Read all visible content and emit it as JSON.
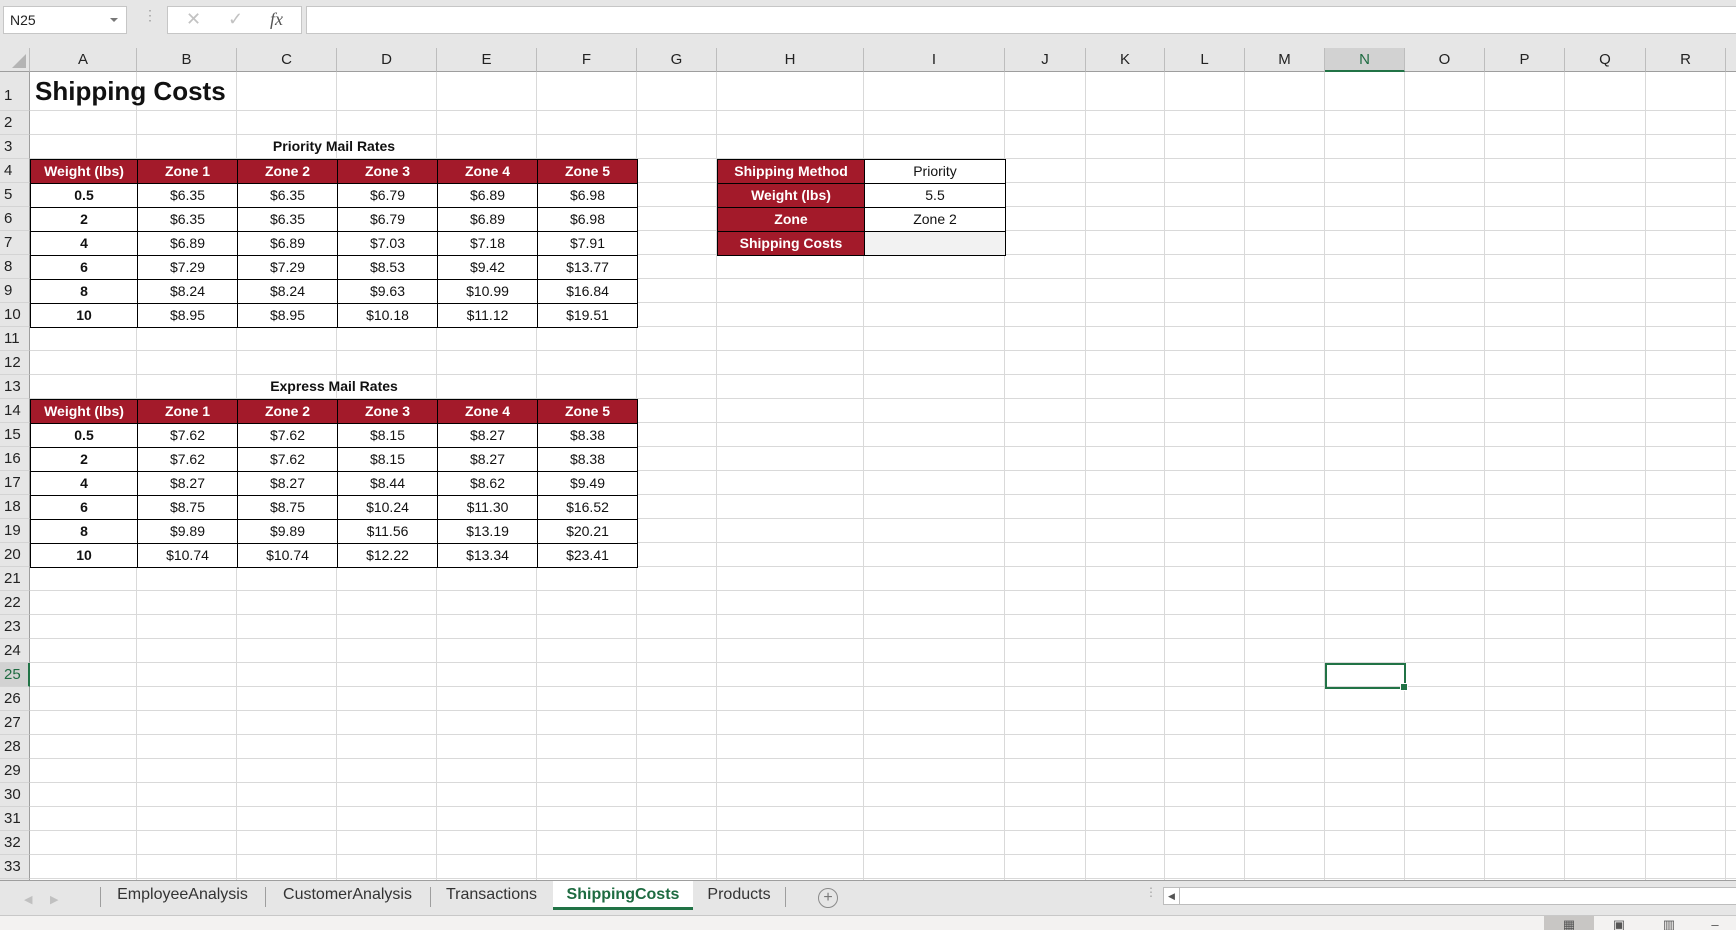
{
  "formula_bar": {
    "name_box": "N25",
    "cancel_icon": "✕",
    "enter_icon": "✓",
    "fx_label": "fx",
    "formula_value": ""
  },
  "columns": [
    "A",
    "B",
    "C",
    "D",
    "E",
    "F",
    "G",
    "H",
    "I",
    "J",
    "K",
    "L",
    "M",
    "N",
    "O",
    "P",
    "Q",
    "R"
  ],
  "selected_column": "N",
  "selected_row": 25,
  "rows": [
    1,
    2,
    3,
    4,
    5,
    6,
    7,
    8,
    9,
    10,
    11,
    12,
    13,
    14,
    15,
    16,
    17,
    18,
    19,
    20,
    21,
    22,
    23,
    24,
    25,
    26,
    27,
    28,
    29,
    30,
    31,
    32,
    33
  ],
  "sheet": {
    "title": "Shipping Costs",
    "priority": {
      "caption": "Priority Mail Rates",
      "headers": [
        "Weight (lbs)",
        "Zone 1",
        "Zone 2",
        "Zone 3",
        "Zone 4",
        "Zone 5"
      ],
      "rows": [
        [
          "0.5",
          "$6.35",
          "$6.35",
          "$6.79",
          "$6.89",
          "$6.98"
        ],
        [
          "2",
          "$6.35",
          "$6.35",
          "$6.79",
          "$6.89",
          "$6.98"
        ],
        [
          "4",
          "$6.89",
          "$6.89",
          "$7.03",
          "$7.18",
          "$7.91"
        ],
        [
          "6",
          "$7.29",
          "$7.29",
          "$8.53",
          "$9.42",
          "$13.77"
        ],
        [
          "8",
          "$8.24",
          "$8.24",
          "$9.63",
          "$10.99",
          "$16.84"
        ],
        [
          "10",
          "$8.95",
          "$8.95",
          "$10.18",
          "$11.12",
          "$19.51"
        ]
      ]
    },
    "express": {
      "caption": "Express Mail Rates",
      "headers": [
        "Weight (lbs)",
        "Zone 1",
        "Zone 2",
        "Zone 3",
        "Zone 4",
        "Zone 5"
      ],
      "rows": [
        [
          "0.5",
          "$7.62",
          "$7.62",
          "$8.15",
          "$8.27",
          "$8.38"
        ],
        [
          "2",
          "$7.62",
          "$7.62",
          "$8.15",
          "$8.27",
          "$8.38"
        ],
        [
          "4",
          "$8.27",
          "$8.27",
          "$8.44",
          "$8.62",
          "$9.49"
        ],
        [
          "6",
          "$8.75",
          "$8.75",
          "$10.24",
          "$11.30",
          "$16.52"
        ],
        [
          "8",
          "$9.89",
          "$9.89",
          "$11.56",
          "$13.19",
          "$20.21"
        ],
        [
          "10",
          "$10.74",
          "$10.74",
          "$12.22",
          "$13.34",
          "$23.41"
        ]
      ]
    },
    "calculator": [
      {
        "label": "Shipping Method",
        "value": "Priority"
      },
      {
        "label": "Weight (lbs)",
        "value": "5.5"
      },
      {
        "label": "Zone",
        "value": "Zone 2"
      },
      {
        "label": "Shipping Costs",
        "value": ""
      }
    ]
  },
  "tabs": {
    "items": [
      "EmployeeAnalysis",
      "CustomerAnalysis",
      "Transactions",
      "ShippingCosts",
      "Products"
    ],
    "active": "ShippingCosts",
    "add_label": "+"
  },
  "colors": {
    "header_fill": "#a31a2a",
    "accent": "#217346",
    "calc_result_fill": "#f2f2f2"
  }
}
